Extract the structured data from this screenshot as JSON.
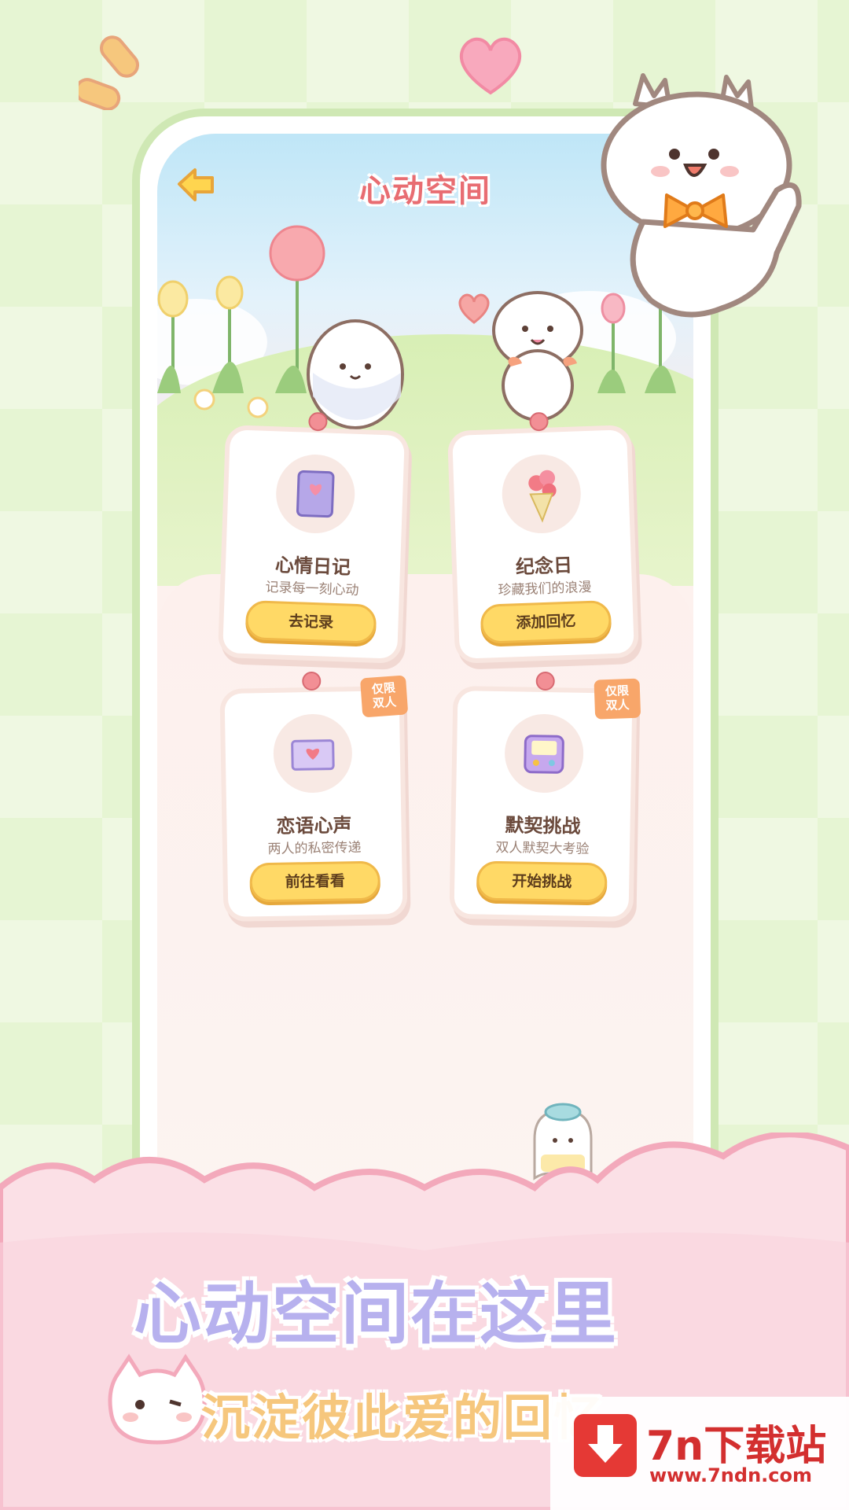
{
  "header": {
    "title": "心动空间"
  },
  "cards": [
    {
      "title": "心情日记",
      "subtitle": "记录每一刻心动",
      "button": "去记录",
      "badge": "",
      "icon": "mood-diary-icon"
    },
    {
      "title": "纪念日",
      "subtitle": "珍藏我们的浪漫",
      "button": "添加回忆",
      "badge": "",
      "icon": "bouquet-icon"
    },
    {
      "title": "恋语心声",
      "subtitle": "两人的私密传递",
      "button": "前往看看",
      "badge": "仅限双人",
      "icon": "love-letter-icon"
    },
    {
      "title": "默契挑战",
      "subtitle": "双人默契大考验",
      "button": "开始挑战",
      "badge": "仅限双人",
      "icon": "game-console-icon"
    }
  ],
  "promo": {
    "headline": "心动空间在这里",
    "subheadline": "沉淀彼此爱的回忆"
  },
  "watermark": {
    "name": "7n下载站",
    "url": "www.7ndn.com"
  },
  "colors": {
    "title": "#e86d72",
    "button": "#ffd966",
    "badge": "#f8a66a",
    "headline": "#b7b1ee",
    "subheadline": "#f6c77d"
  }
}
